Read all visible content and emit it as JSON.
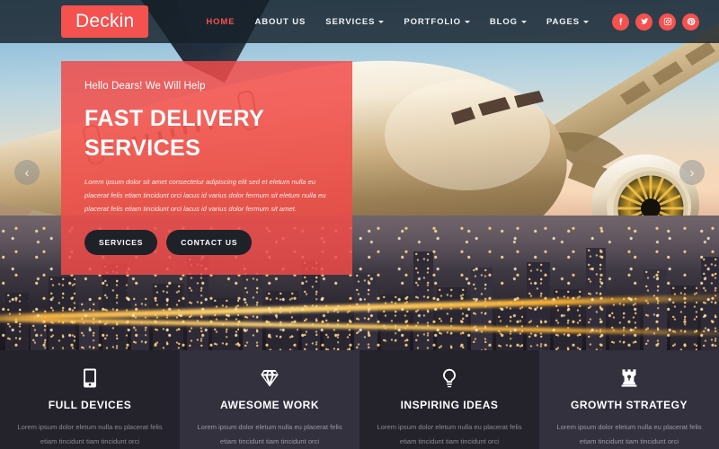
{
  "header": {
    "logo": "Deckin",
    "nav": [
      {
        "label": "HOME",
        "active": true,
        "caret": false
      },
      {
        "label": "ABOUT US",
        "active": false,
        "caret": false
      },
      {
        "label": "SERVICES",
        "active": false,
        "caret": true
      },
      {
        "label": "PORTFOLIO",
        "active": false,
        "caret": true
      },
      {
        "label": "BLOG",
        "active": false,
        "caret": true
      },
      {
        "label": "PAGES",
        "active": false,
        "caret": true
      }
    ],
    "socials": [
      {
        "name": "facebook-icon"
      },
      {
        "name": "twitter-icon"
      },
      {
        "name": "instagram-icon"
      },
      {
        "name": "pinterest-icon"
      }
    ]
  },
  "hero": {
    "kicker": "Hello Dears! We Will Help",
    "title_line1": "FAST DELIVERY",
    "title_line2": "SERVICES",
    "paragraph": "Lorem ipsum dolor sit amet consectetur adipiscing elit sed et eletum nulla eu placerat felis etiam tincidunt orci lacus id varius dolor fermum sit eletum nulla eu placerat felis etiam tincidunt orci lacus id varius dolor fermum sit amet.",
    "primary_button": "SERVICES",
    "secondary_button": "CONTACT US",
    "prev_arrow": "‹",
    "next_arrow": "›"
  },
  "features": [
    {
      "icon": "mobile-phone-icon",
      "title": "FULL DEVICES",
      "text": "Lorem ipsum dolor eletum nulla eu placerat felis etiam tincidunt tiam tincidunt orci"
    },
    {
      "icon": "diamond-icon",
      "title": "AWESOME WORK",
      "text": "Lorem ipsum dolor eletum nulla eu placerat felis etiam tincidunt tiam tincidunt orci"
    },
    {
      "icon": "lightbulb-icon",
      "title": "INSPIRING IDEAS",
      "text": "Lorem ipsum dolor eletum nulla eu placerat felis etiam tincidunt tiam tincidunt orci"
    },
    {
      "icon": "chess-rook-icon",
      "title": "GROWTH STRATEGY",
      "text": "Lorem ipsum dolor eletum nulla eu placerat felis etiam tincidunt tiam tincidunt orci"
    }
  ],
  "colors": {
    "accent": "#f4514f",
    "header_bg": "#17212a",
    "card_dark": "#24222a",
    "card_light": "#32313d",
    "button_dark": "#1f2129"
  }
}
